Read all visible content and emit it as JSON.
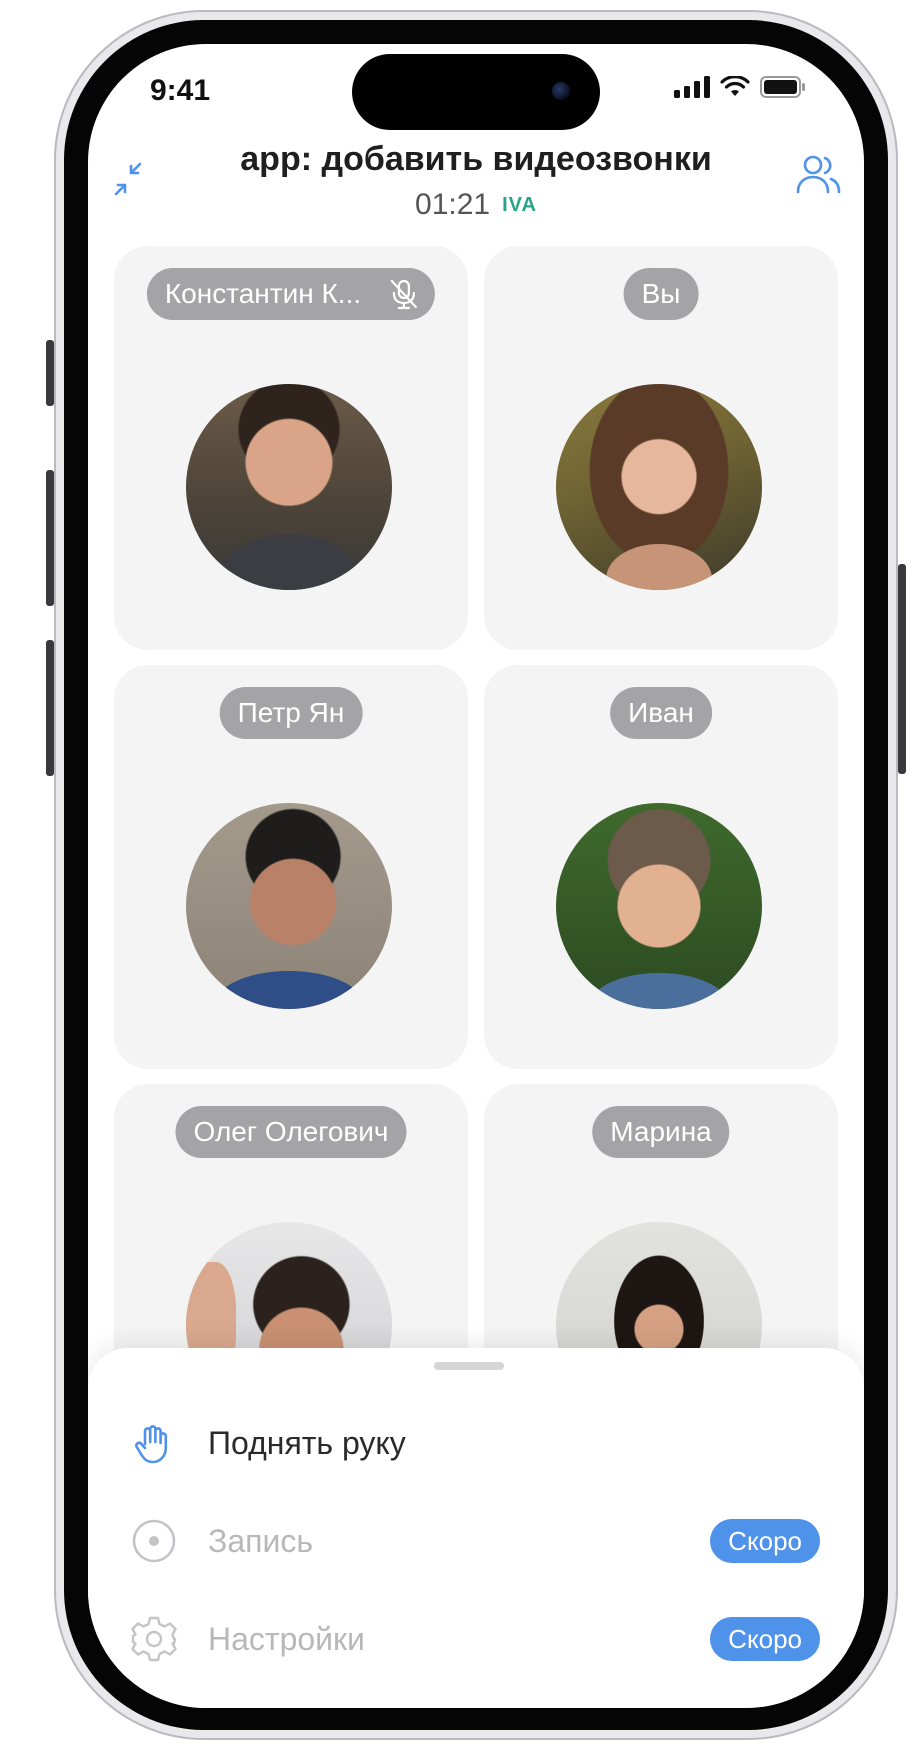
{
  "status_bar": {
    "time": "9:41"
  },
  "header": {
    "title": "app: добавить видеозвонки",
    "timer": "01:21",
    "logo": "IVA"
  },
  "participants": [
    {
      "name": "Константин К...",
      "muted": true
    },
    {
      "name": "Вы",
      "muted": false
    },
    {
      "name": "Петр Ян",
      "muted": false
    },
    {
      "name": "Иван",
      "muted": false
    },
    {
      "name": "Олег Олегович",
      "muted": false
    },
    {
      "name": "Марина",
      "muted": false
    }
  ],
  "sheet": {
    "items": [
      {
        "label": "Поднять руку",
        "icon": "hand-icon",
        "enabled": true
      },
      {
        "label": "Запись",
        "icon": "record-icon",
        "enabled": false,
        "badge": "Скоро"
      },
      {
        "label": "Настройки",
        "icon": "gear-icon",
        "enabled": false,
        "badge": "Скоро"
      }
    ]
  },
  "colors": {
    "accent": "#4f92ea",
    "pill": "#a4a4a6",
    "tile": "#f4f4f5",
    "logo": "#27a58a"
  }
}
